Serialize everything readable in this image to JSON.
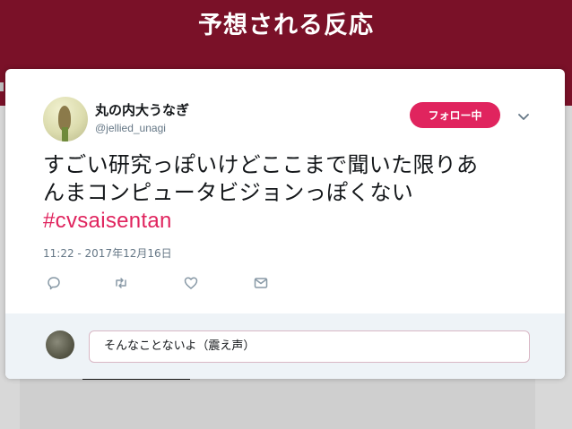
{
  "slide": {
    "title": "予想される反応"
  },
  "tweet": {
    "author_name": "丸の内大うなぎ",
    "author_handle": "@jellied_unagi",
    "follow_label": "フォロー中",
    "text_line1": "すごい研究っぽいけどここまで聞いた限りあ",
    "text_line2": "んまコンピュータビジョンっぽくない",
    "hashtag": "#cvsaisentan",
    "timestamp": "11:22 - 2017年12月16日"
  },
  "reply": {
    "value": "そんなことないよ（震え声）"
  },
  "icons": {
    "menu": "chevron-down-icon",
    "reply": "reply-icon",
    "retweet": "retweet-icon",
    "like": "heart-icon",
    "dm": "envelope-icon"
  },
  "colors": {
    "slide_background": "#7a1128",
    "accent": "#e0245e",
    "text": "#14171a",
    "secondary_text": "#657786"
  }
}
